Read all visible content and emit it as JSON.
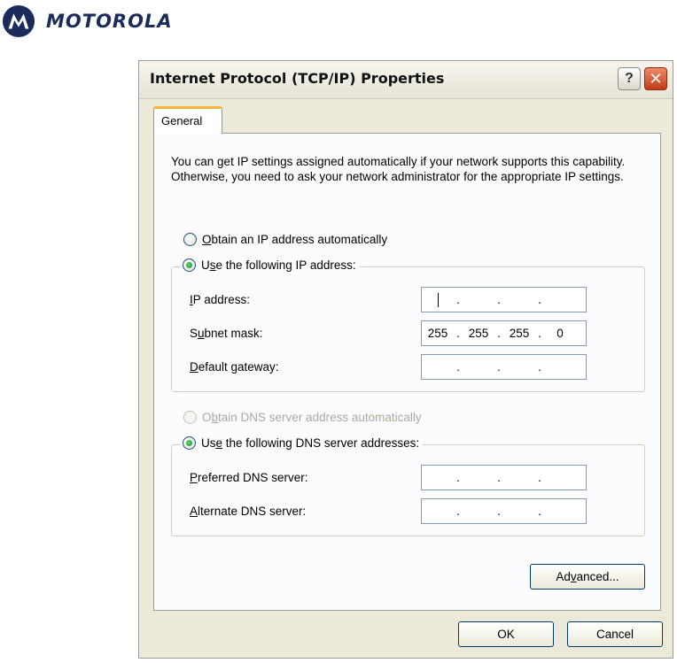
{
  "brand": {
    "name": "MOTOROLA"
  },
  "dialog": {
    "title": "Internet Protocol (TCP/IP) Properties",
    "help_glyph": "?",
    "close_glyph": "✕",
    "tab_label": "General",
    "intro_text": "You can get IP settings assigned automatically if your network supports this capability. Otherwise, you need to ask your network administrator for the appropriate IP settings.",
    "ip_section": {
      "auto_option": {
        "before": "",
        "accel": "O",
        "after": "btain an IP address automatically",
        "checked": false
      },
      "manual_option": {
        "before": "U",
        "accel": "s",
        "after": "e the following IP address:",
        "checked": true
      },
      "fields": [
        {
          "before": "",
          "accel": "I",
          "after": "P address:",
          "octets": [
            "",
            "",
            "",
            ""
          ],
          "focused": true
        },
        {
          "before": "S",
          "accel": "u",
          "after": "bnet mask:",
          "octets": [
            "255",
            "255",
            "255",
            "0"
          ],
          "focused": false
        },
        {
          "before": "",
          "accel": "D",
          "after": "efault gateway:",
          "octets": [
            "",
            "",
            "",
            ""
          ],
          "focused": false
        }
      ]
    },
    "dns_section": {
      "auto_option": {
        "before": "O",
        "accel": "b",
        "after": "tain DNS server address automatically",
        "checked": false,
        "disabled": true
      },
      "manual_option": {
        "before": "Us",
        "accel": "e",
        "after": " the following DNS server addresses:",
        "checked": true
      },
      "fields": [
        {
          "before": "",
          "accel": "P",
          "after": "referred DNS server:",
          "octets": [
            "",
            "",
            "",
            ""
          ]
        },
        {
          "before": "",
          "accel": "A",
          "after": "lternate DNS server:",
          "octets": [
            "",
            "",
            "",
            ""
          ]
        }
      ]
    },
    "buttons": {
      "advanced": {
        "before": "Ad",
        "accel": "v",
        "after": "anced..."
      },
      "ok": "OK",
      "cancel": "Cancel"
    }
  },
  "colors": {
    "dialog_bg": "#ece9d8",
    "panel_bg": "#fcfcfe",
    "tab_highlight": "#f6b53b",
    "close_button": "#c23b17",
    "brand_text": "#1a2b5c",
    "field_border": "#7f9db9"
  }
}
